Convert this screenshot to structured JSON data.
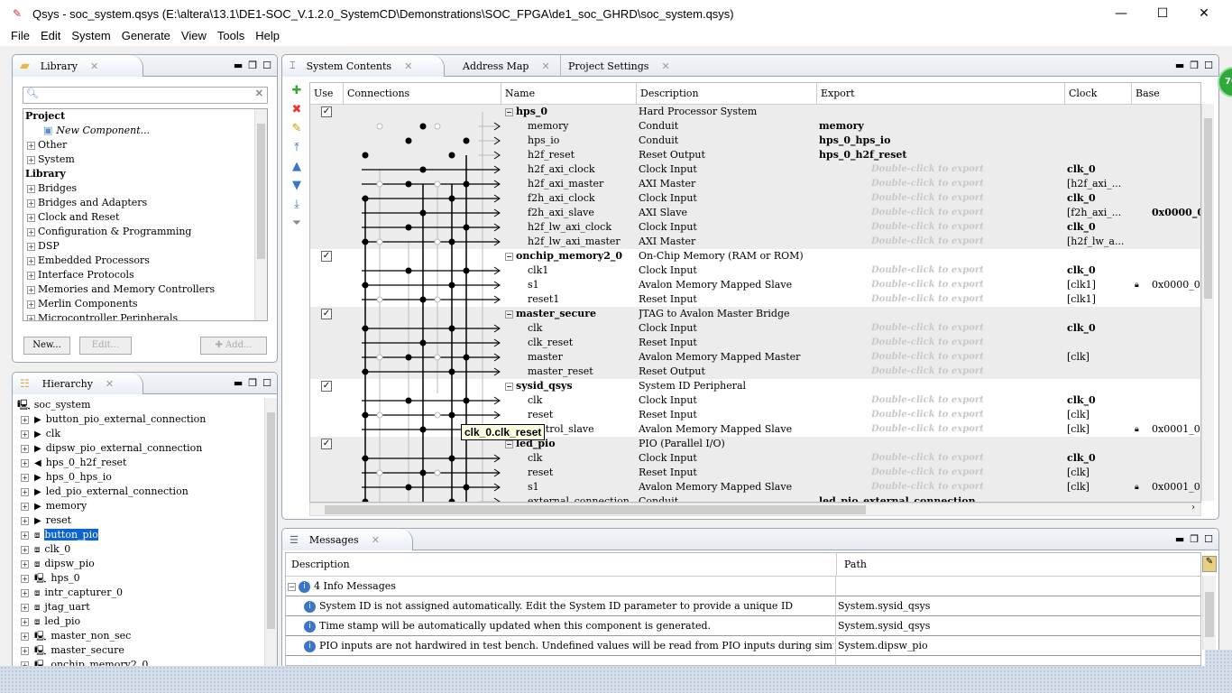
{
  "window": {
    "title": "Qsys - soc_system.qsys (E:\\altera\\13.1\\DE1-SOC_V.1.2.0_SystemCD\\Demonstrations\\SOC_FPGA\\de1_soc_GHRD\\soc_system.qsys)",
    "minimize": "—",
    "maximize": "☐",
    "close": "✕"
  },
  "menu": [
    "File",
    "Edit",
    "System",
    "Generate",
    "View",
    "Tools",
    "Help"
  ],
  "library": {
    "tab": "Library",
    "search_placeholder": "",
    "items": [
      {
        "label": "Project",
        "kind": "header"
      },
      {
        "label": "New Component...",
        "kind": "new"
      },
      {
        "label": "Other",
        "kind": "node"
      },
      {
        "label": "System",
        "kind": "node"
      },
      {
        "label": "Library",
        "kind": "header"
      },
      {
        "label": "Bridges",
        "kind": "node"
      },
      {
        "label": "Bridges and Adapters",
        "kind": "node"
      },
      {
        "label": "Clock and Reset",
        "kind": "node"
      },
      {
        "label": "Configuration & Programming",
        "kind": "node"
      },
      {
        "label": "DSP",
        "kind": "node"
      },
      {
        "label": "Embedded Processors",
        "kind": "node"
      },
      {
        "label": "Interface Protocols",
        "kind": "node"
      },
      {
        "label": "Memories and Memory Controllers",
        "kind": "node"
      },
      {
        "label": "Merlin Components",
        "kind": "node"
      },
      {
        "label": "Microcontroller Peripherals",
        "kind": "node"
      }
    ],
    "buttons": {
      "new": "New...",
      "edit": "Edit...",
      "add": "Add..."
    }
  },
  "hierarchy": {
    "tab": "Hierarchy",
    "root": "soc_system",
    "selected": "button_pio",
    "items": [
      {
        "label": "button_pio_external_connection",
        "icon": "export"
      },
      {
        "label": "clk",
        "icon": "export"
      },
      {
        "label": "dipsw_pio_external_connection",
        "icon": "export"
      },
      {
        "label": "hps_0_h2f_reset",
        "icon": "export-out"
      },
      {
        "label": "hps_0_hps_io",
        "icon": "export"
      },
      {
        "label": "led_pio_external_connection",
        "icon": "export"
      },
      {
        "label": "memory",
        "icon": "export"
      },
      {
        "label": "reset",
        "icon": "export"
      },
      {
        "label": "button_pio",
        "icon": "component"
      },
      {
        "label": "clk_0",
        "icon": "component"
      },
      {
        "label": "dipsw_pio",
        "icon": "component"
      },
      {
        "label": "hps_0",
        "icon": "system"
      },
      {
        "label": "intr_capturer_0",
        "icon": "component"
      },
      {
        "label": "jtag_uart",
        "icon": "component"
      },
      {
        "label": "led_pio",
        "icon": "component"
      },
      {
        "label": "master_non_sec",
        "icon": "system"
      },
      {
        "label": "master_secure",
        "icon": "system"
      },
      {
        "label": "onchip_memory2_0",
        "icon": "system"
      }
    ]
  },
  "main": {
    "tabs": [
      "System Contents",
      "Address Map",
      "Project Settings"
    ],
    "columns": [
      "Use",
      "Connections",
      "Name",
      "Description",
      "Export",
      "Clock",
      "Base"
    ],
    "export_hint": "Double-click to export",
    "rows": [
      {
        "name": "hps_0",
        "desc": "Hard Processor System",
        "group": true,
        "use": true,
        "shade": 1
      },
      {
        "name": "memory",
        "desc": "Conduit",
        "export": "memory",
        "shade": 1
      },
      {
        "name": "hps_io",
        "desc": "Conduit",
        "export": "hps_0_hps_io",
        "shade": 1
      },
      {
        "name": "h2f_reset",
        "desc": "Reset Output",
        "export": "hps_0_h2f_reset",
        "shade": 1
      },
      {
        "name": "h2f_axi_clock",
        "desc": "Clock Input",
        "hint": true,
        "clock": "clk_0",
        "clockBold": true,
        "shade": 1
      },
      {
        "name": "h2f_axi_master",
        "desc": "AXI Master",
        "hint": true,
        "clock": "[h2f_axi_...",
        "shade": 1
      },
      {
        "name": "f2h_axi_clock",
        "desc": "Clock Input",
        "hint": true,
        "clock": "clk_0",
        "clockBold": true,
        "shade": 1
      },
      {
        "name": "f2h_axi_slave",
        "desc": "AXI Slave",
        "hint": true,
        "clock": "[f2h_axi_...",
        "base": "0x0000_0",
        "baseBold": true,
        "shade": 1
      },
      {
        "name": "h2f_lw_axi_clock",
        "desc": "Clock Input",
        "hint": true,
        "clock": "clk_0",
        "clockBold": true,
        "shade": 1
      },
      {
        "name": "h2f_lw_axi_master",
        "desc": "AXI Master",
        "hint": true,
        "clock": "[h2f_lw_a...",
        "shade": 1
      },
      {
        "name": "onchip_memory2_0",
        "desc": "On-Chip Memory (RAM or ROM)",
        "group": true,
        "use": true,
        "shade": 0
      },
      {
        "name": "clk1",
        "desc": "Clock Input",
        "hint": true,
        "clock": "clk_0",
        "clockBold": true,
        "shade": 0
      },
      {
        "name": "s1",
        "desc": "Avalon Memory Mapped Slave",
        "hint": true,
        "clock": "[clk1]",
        "base": "0x0000_00",
        "lock": true,
        "shade": 0
      },
      {
        "name": "reset1",
        "desc": "Reset Input",
        "hint": true,
        "clock": "[clk1]",
        "shade": 0
      },
      {
        "name": "master_secure",
        "desc": "JTAG to Avalon Master Bridge",
        "group": true,
        "use": true,
        "shade": 1
      },
      {
        "name": "clk",
        "desc": "Clock Input",
        "hint": true,
        "clock": "clk_0",
        "clockBold": true,
        "shade": 1
      },
      {
        "name": "clk_reset",
        "desc": "Reset Input",
        "hint": true,
        "shade": 1
      },
      {
        "name": "master",
        "desc": "Avalon Memory Mapped Master",
        "hint": true,
        "clock": "[clk]",
        "shade": 1
      },
      {
        "name": "master_reset",
        "desc": "Reset Output",
        "hint": true,
        "shade": 1
      },
      {
        "name": "sysid_qsys",
        "desc": "System ID Peripheral",
        "group": true,
        "use": true,
        "shade": 0
      },
      {
        "name": "clk",
        "desc": "Clock Input",
        "hint": true,
        "clock": "clk_0",
        "clockBold": true,
        "shade": 0
      },
      {
        "name": "reset",
        "desc": "Reset Input",
        "hint": true,
        "clock": "[clk]",
        "shade": 0
      },
      {
        "name": "control_slave",
        "desc": "Avalon Memory Mapped Slave",
        "hint": true,
        "clock": "[clk]",
        "base": "0x0001_00",
        "lock": true,
        "shade": 0
      },
      {
        "name": "led_pio",
        "desc": "PIO (Parallel I/O)",
        "group": true,
        "use": true,
        "shade": 1
      },
      {
        "name": "clk",
        "desc": "Clock Input",
        "hint": true,
        "clock": "clk_0",
        "clockBold": true,
        "shade": 1
      },
      {
        "name": "reset",
        "desc": "Reset Input",
        "hint": true,
        "clock": "[clk]",
        "shade": 1
      },
      {
        "name": "s1",
        "desc": "Avalon Memory Mapped Slave",
        "hint": true,
        "clock": "[clk]",
        "base": "0x0001_00",
        "lock": true,
        "shade": 1
      },
      {
        "name": "external_connection",
        "desc": "Conduit",
        "export": "led_pio_external_connection",
        "shade": 1
      }
    ],
    "tooltip": "clk_0.clk_reset"
  },
  "messages": {
    "tab": "Messages",
    "columns": [
      "Description",
      "Path"
    ],
    "group": "4 Info Messages",
    "items": [
      {
        "text": "System ID is not assigned automatically. Edit the System ID parameter to provide a unique ID",
        "path": "System.sysid_qsys"
      },
      {
        "text": "Time stamp will be automatically updated when this component is generated.",
        "path": "System.sysid_qsys"
      },
      {
        "text": "PIO inputs are not hardwired in test bench. Undefined values will be read from PIO inputs during simulation.",
        "path": "System.dipsw_pio"
      }
    ]
  },
  "badge": "70",
  "colors": {
    "selection": "#0a64d2",
    "info": "#3b74c9",
    "badge": "#2eaa3c"
  }
}
